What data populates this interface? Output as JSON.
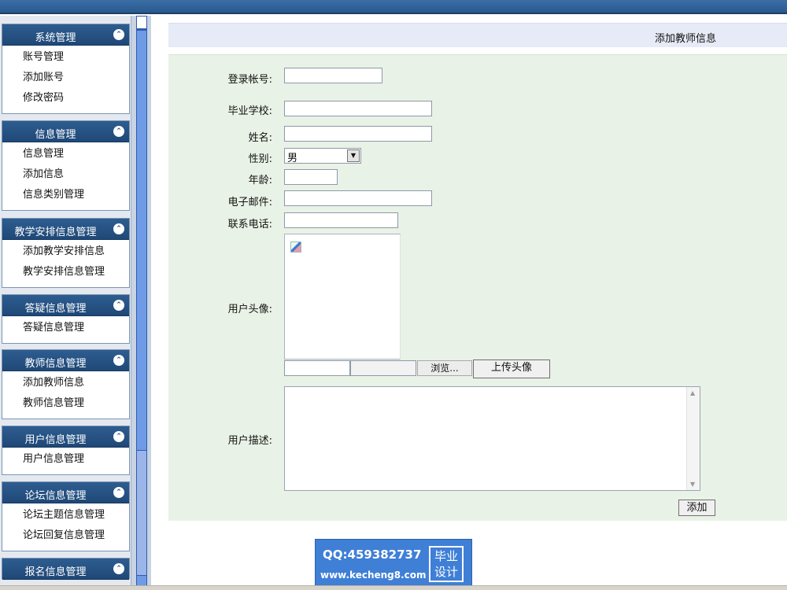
{
  "sidebar": {
    "groups": [
      {
        "title": "系统管理",
        "toggle": "⌃",
        "items": [
          "账号管理",
          "添加账号",
          "修改密码"
        ]
      },
      {
        "title": "信息管理",
        "toggle": "⌃",
        "items": [
          "信息管理",
          "添加信息",
          "信息类别管理"
        ]
      },
      {
        "title": "教学安排信息管理",
        "toggle": "⌃",
        "items": [
          "添加教学安排信息",
          "教学安排信息管理"
        ]
      },
      {
        "title": "答疑信息管理",
        "toggle": "⌃",
        "items": [
          "答疑信息管理"
        ]
      },
      {
        "title": "教师信息管理",
        "toggle": "⌃",
        "items": [
          "添加教师信息",
          "教师信息管理"
        ]
      },
      {
        "title": "用户信息管理",
        "toggle": "⌃",
        "items": [
          "用户信息管理"
        ]
      },
      {
        "title": "论坛信息管理",
        "toggle": "⌃",
        "items": [
          "论坛主题信息管理",
          "论坛回复信息管理"
        ]
      },
      {
        "title": "报名信息管理",
        "toggle": "⌃",
        "items": []
      }
    ]
  },
  "main": {
    "page_title": "添加教师信息",
    "form": {
      "login_label": "登录帐号:",
      "login_value": "",
      "school_label": "毕业学校:",
      "school_value": "",
      "name_label": "姓名:",
      "name_value": "",
      "gender_label": "性别:",
      "gender_value": "男",
      "age_label": "年龄:",
      "age_value": "",
      "email_label": "电子邮件:",
      "email_value": "",
      "phone_label": "联系电话:",
      "phone_value": "",
      "avatar_label": "用户头像:",
      "browse_label": "浏览...",
      "upload_label": "上传头像",
      "desc_label": "用户描述:",
      "desc_value": "",
      "submit_label": "添加"
    }
  },
  "watermark": {
    "qq": "QQ:459382737",
    "site": "www.kecheng8.com",
    "badge_line1": "毕业",
    "badge_line2": "设计"
  }
}
